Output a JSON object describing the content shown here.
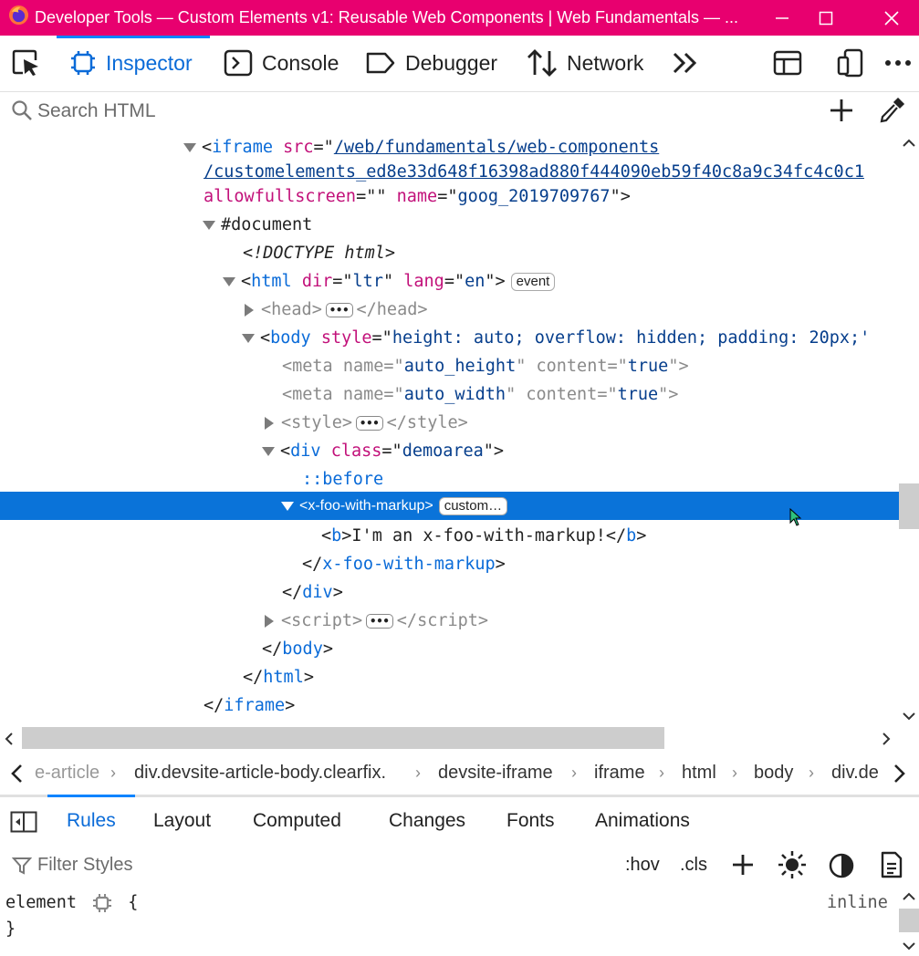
{
  "window": {
    "title": "Developer Tools — Custom Elements v1: Reusable Web Components  |  Web Fundamentals — ..."
  },
  "toolbar": {
    "tabs": [
      {
        "label": "Inspector",
        "icon": "inspector-icon",
        "active": true
      },
      {
        "label": "Console",
        "icon": "console-icon",
        "active": false
      },
      {
        "label": "Debugger",
        "icon": "debugger-icon",
        "active": false
      },
      {
        "label": "Network",
        "icon": "network-icon",
        "active": false
      }
    ]
  },
  "search": {
    "placeholder": "Search HTML"
  },
  "markup": {
    "iframe_src_1": "/web/fundamentals/web-components",
    "iframe_src_2": "/customelements_ed8e33d648f16398ad880f444090eb59f40c8a9c34fc4c0c1",
    "iframe_name": "goog_2019709767",
    "document": "#document",
    "doctype": "<!DOCTYPE html>",
    "html_dir": "ltr",
    "html_lang": "en",
    "event_badge": "event",
    "body_style": "height: auto; overflow: hidden; padding: 20px;'",
    "meta1_name": "auto_height",
    "meta1_content": "true",
    "meta2_name": "auto_width",
    "meta2_content": "true",
    "div_class": "demoarea",
    "pseudo": "::before",
    "selected_tag": "x-foo-with-markup",
    "custom_badge": "custom…",
    "b_text": "I'm an x-foo-with-markup!"
  },
  "breadcrumbs": [
    "e-article",
    "div.devsite-article-body.clearfix.",
    "devsite-iframe",
    "iframe",
    "html",
    "body",
    "div.de"
  ],
  "sidebar": {
    "tabs": [
      "Rules",
      "Layout",
      "Computed",
      "Changes",
      "Fonts",
      "Animations"
    ],
    "active": "Rules",
    "filter_placeholder": "Filter Styles",
    "hov": ":hov",
    "cls": ".cls"
  },
  "rules": {
    "selector": "element",
    "open_brace": "{",
    "close_brace": "}",
    "source": "inline"
  },
  "colors": {
    "titlebar": "#e8006f",
    "accent": "#0a84ff",
    "selection": "#0a73d9"
  }
}
